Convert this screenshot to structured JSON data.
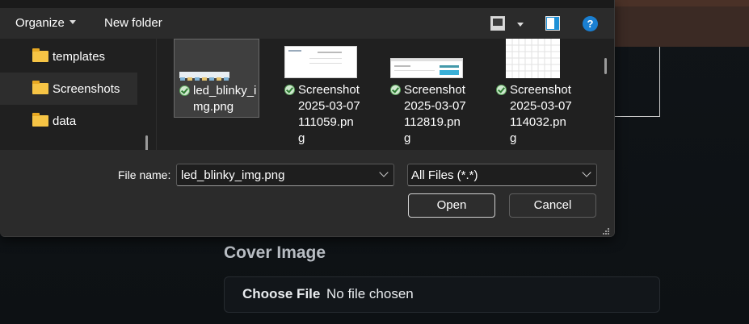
{
  "toolbar": {
    "organize": "Organize",
    "new_folder": "New folder",
    "view_icon": "view-icon",
    "preview_pane_icon": "preview-pane-icon",
    "help_icon": "help-icon",
    "help_glyph": "?"
  },
  "nav": {
    "items": [
      {
        "label": "templates",
        "icon": "folder-icon"
      },
      {
        "label": "Screenshots",
        "icon": "folder-icon",
        "selected": true
      },
      {
        "label": "data",
        "icon": "folder-icon"
      }
    ]
  },
  "files": [
    {
      "name_lines": [
        "led_blinky_i",
        "mg.png"
      ],
      "selected": true
    },
    {
      "name_lines": [
        "Screenshot",
        "2025-03-07",
        "111059.pn",
        "g"
      ]
    },
    {
      "name_lines": [
        "Screenshot",
        "2025-03-07",
        "112819.pn",
        "g"
      ]
    },
    {
      "name_lines": [
        "Screenshot",
        "2025-03-07",
        "114032.pn",
        "g"
      ]
    }
  ],
  "bottom": {
    "file_name_label": "File name:",
    "file_name_value": "led_blinky_img.png",
    "file_type_value": "All Files (*.*)",
    "open_label": "Open",
    "cancel_label": "Cancel"
  },
  "page": {
    "cover_image_label": "Cover Image",
    "choose_file_label": "Choose File",
    "no_file_text": "No file chosen"
  },
  "colors": {
    "dialog_bg": "#202020",
    "toolbar_bg": "#2b2b2b",
    "folder": "#f6c445",
    "help_blue": "#1a7fd1"
  }
}
